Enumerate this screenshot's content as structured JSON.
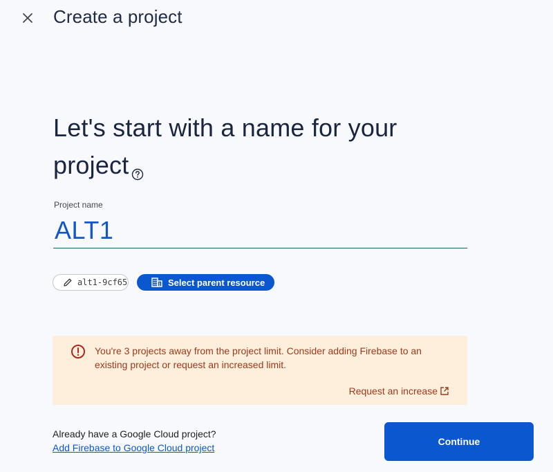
{
  "header": {
    "title": "Create a project",
    "close_icon": "close-icon"
  },
  "main": {
    "heading": "Let's start with a name for your project",
    "help_icon": "help-circle-icon",
    "project_name": {
      "label": "Project name",
      "value": "ALT1"
    },
    "project_id_chip": {
      "label": "alt1-9cf65",
      "icon": "pencil-icon"
    },
    "parent_resource_chip": {
      "label": "Select parent resource",
      "icon": "building-icon"
    }
  },
  "warning": {
    "icon": "error-icon",
    "message": "You're 3 projects away from the project limit. Consider adding Firebase to an existing project or request an increased limit.",
    "link_label": "Request an increase",
    "link_icon": "open-in-new-icon"
  },
  "footer": {
    "question": "Already have a Google Cloud project?",
    "link_label": "Add Firebase to Google Cloud project",
    "continue_label": "Continue"
  },
  "colors": {
    "accent": "#0b57d0",
    "warning_bg": "#fdefdc",
    "warning_text": "#a1391a",
    "input_text": "#1457c4",
    "background": "#f8f9fd"
  }
}
